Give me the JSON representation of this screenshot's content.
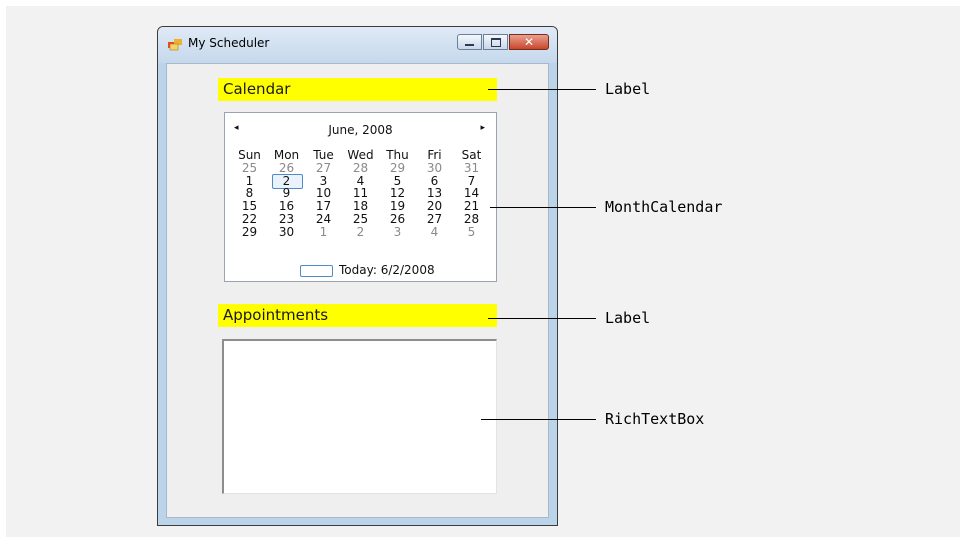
{
  "window": {
    "title": "My Scheduler",
    "minimize_glyph": "",
    "maximize_glyph": "",
    "close_glyph": "✕"
  },
  "labels": {
    "calendar": "Calendar",
    "appointments": "Appointments"
  },
  "calendar": {
    "prev_glyph": "◂",
    "next_glyph": "▸",
    "month_title": "June, 2008",
    "day_names": [
      "Sun",
      "Mon",
      "Tue",
      "Wed",
      "Thu",
      "Fri",
      "Sat"
    ],
    "weeks": [
      [
        {
          "d": "25",
          "o": true
        },
        {
          "d": "26",
          "o": true
        },
        {
          "d": "27",
          "o": true
        },
        {
          "d": "28",
          "o": true
        },
        {
          "d": "29",
          "o": true
        },
        {
          "d": "30",
          "o": true
        },
        {
          "d": "31",
          "o": true
        }
      ],
      [
        {
          "d": "1"
        },
        {
          "d": "2",
          "sel": true
        },
        {
          "d": "3"
        },
        {
          "d": "4"
        },
        {
          "d": "5"
        },
        {
          "d": "6"
        },
        {
          "d": "7"
        }
      ],
      [
        {
          "d": "8"
        },
        {
          "d": "9"
        },
        {
          "d": "10"
        },
        {
          "d": "11"
        },
        {
          "d": "12"
        },
        {
          "d": "13"
        },
        {
          "d": "14"
        }
      ],
      [
        {
          "d": "15"
        },
        {
          "d": "16"
        },
        {
          "d": "17"
        },
        {
          "d": "18"
        },
        {
          "d": "19"
        },
        {
          "d": "20"
        },
        {
          "d": "21"
        }
      ],
      [
        {
          "d": "22"
        },
        {
          "d": "23"
        },
        {
          "d": "24"
        },
        {
          "d": "25"
        },
        {
          "d": "26"
        },
        {
          "d": "27"
        },
        {
          "d": "28"
        }
      ],
      [
        {
          "d": "29"
        },
        {
          "d": "30"
        },
        {
          "d": "1",
          "o": true
        },
        {
          "d": "2",
          "o": true
        },
        {
          "d": "3",
          "o": true
        },
        {
          "d": "4",
          "o": true
        },
        {
          "d": "5",
          "o": true
        }
      ]
    ],
    "today_text": "Today: 6/2/2008"
  },
  "rich_text_box": {
    "value": ""
  },
  "callouts": [
    {
      "text": "Label"
    },
    {
      "text": "MonthCalendar"
    },
    {
      "text": "Label"
    },
    {
      "text": "RichTextBox"
    }
  ],
  "colors": {
    "label_background": "#ffff00",
    "selection_border": "#4f8ac9"
  }
}
